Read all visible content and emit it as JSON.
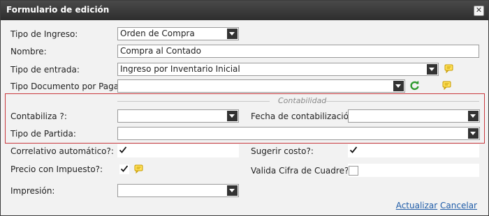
{
  "dialog": {
    "title": "Formulario de edición",
    "close_glyph": "✕"
  },
  "fields": {
    "tipo_ingreso": {
      "label": "Tipo de Ingreso:",
      "value": "Orden de Compra"
    },
    "nombre": {
      "label": "Nombre:",
      "value": "Compra al Contado"
    },
    "tipo_entrada": {
      "label": "Tipo de entrada:",
      "value": "Ingreso por Inventario Inicial"
    },
    "tipo_documento": {
      "label": "Tipo Documento por Pagar:",
      "value": ""
    }
  },
  "contabilidad": {
    "legend": "Contabilidad",
    "contabiliza": {
      "label": "Contabiliza ?:",
      "value": ""
    },
    "fecha": {
      "label": "Fecha de contabilización:",
      "value": ""
    },
    "tipo_partida": {
      "label": "Tipo de Partida:",
      "value": ""
    }
  },
  "options": {
    "correlativo": {
      "label": "Correlativo automático?:",
      "checked": true
    },
    "sugerir_costo": {
      "label": "Sugerir costo?:",
      "checked": true
    },
    "precio_impuesto": {
      "label": "Precio con Impuesto?:",
      "checked": true
    },
    "valida_cifra": {
      "label": "Valida Cifra de Cuadre?:",
      "checked": false
    }
  },
  "impresion": {
    "label": "Impresión:",
    "value": ""
  },
  "actions": {
    "update": "Actualizar",
    "cancel": "Cancelar"
  },
  "colors": {
    "section_border": "#c9383d",
    "link": "#1f5ca8",
    "refresh_icon": "#2f9a2f",
    "note_icon": "#e2b400"
  },
  "icons": [
    "close-icon",
    "dropdown-arrow-icon",
    "note-icon",
    "refresh-icon",
    "checkmark-icon"
  ]
}
